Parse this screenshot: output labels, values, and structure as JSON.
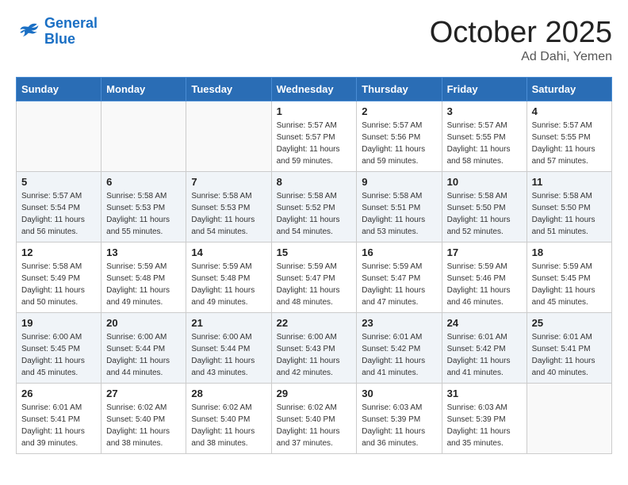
{
  "header": {
    "logo_line1": "General",
    "logo_line2": "Blue",
    "month": "October 2025",
    "location": "Ad Dahi, Yemen"
  },
  "weekdays": [
    "Sunday",
    "Monday",
    "Tuesday",
    "Wednesday",
    "Thursday",
    "Friday",
    "Saturday"
  ],
  "weeks": [
    [
      {
        "day": "",
        "sunrise": "",
        "sunset": "",
        "daylight": ""
      },
      {
        "day": "",
        "sunrise": "",
        "sunset": "",
        "daylight": ""
      },
      {
        "day": "",
        "sunrise": "",
        "sunset": "",
        "daylight": ""
      },
      {
        "day": "1",
        "sunrise": "Sunrise: 5:57 AM",
        "sunset": "Sunset: 5:57 PM",
        "daylight": "Daylight: 11 hours and 59 minutes."
      },
      {
        "day": "2",
        "sunrise": "Sunrise: 5:57 AM",
        "sunset": "Sunset: 5:56 PM",
        "daylight": "Daylight: 11 hours and 59 minutes."
      },
      {
        "day": "3",
        "sunrise": "Sunrise: 5:57 AM",
        "sunset": "Sunset: 5:55 PM",
        "daylight": "Daylight: 11 hours and 58 minutes."
      },
      {
        "day": "4",
        "sunrise": "Sunrise: 5:57 AM",
        "sunset": "Sunset: 5:55 PM",
        "daylight": "Daylight: 11 hours and 57 minutes."
      }
    ],
    [
      {
        "day": "5",
        "sunrise": "Sunrise: 5:57 AM",
        "sunset": "Sunset: 5:54 PM",
        "daylight": "Daylight: 11 hours and 56 minutes."
      },
      {
        "day": "6",
        "sunrise": "Sunrise: 5:58 AM",
        "sunset": "Sunset: 5:53 PM",
        "daylight": "Daylight: 11 hours and 55 minutes."
      },
      {
        "day": "7",
        "sunrise": "Sunrise: 5:58 AM",
        "sunset": "Sunset: 5:53 PM",
        "daylight": "Daylight: 11 hours and 54 minutes."
      },
      {
        "day": "8",
        "sunrise": "Sunrise: 5:58 AM",
        "sunset": "Sunset: 5:52 PM",
        "daylight": "Daylight: 11 hours and 54 minutes."
      },
      {
        "day": "9",
        "sunrise": "Sunrise: 5:58 AM",
        "sunset": "Sunset: 5:51 PM",
        "daylight": "Daylight: 11 hours and 53 minutes."
      },
      {
        "day": "10",
        "sunrise": "Sunrise: 5:58 AM",
        "sunset": "Sunset: 5:50 PM",
        "daylight": "Daylight: 11 hours and 52 minutes."
      },
      {
        "day": "11",
        "sunrise": "Sunrise: 5:58 AM",
        "sunset": "Sunset: 5:50 PM",
        "daylight": "Daylight: 11 hours and 51 minutes."
      }
    ],
    [
      {
        "day": "12",
        "sunrise": "Sunrise: 5:58 AM",
        "sunset": "Sunset: 5:49 PM",
        "daylight": "Daylight: 11 hours and 50 minutes."
      },
      {
        "day": "13",
        "sunrise": "Sunrise: 5:59 AM",
        "sunset": "Sunset: 5:48 PM",
        "daylight": "Daylight: 11 hours and 49 minutes."
      },
      {
        "day": "14",
        "sunrise": "Sunrise: 5:59 AM",
        "sunset": "Sunset: 5:48 PM",
        "daylight": "Daylight: 11 hours and 49 minutes."
      },
      {
        "day": "15",
        "sunrise": "Sunrise: 5:59 AM",
        "sunset": "Sunset: 5:47 PM",
        "daylight": "Daylight: 11 hours and 48 minutes."
      },
      {
        "day": "16",
        "sunrise": "Sunrise: 5:59 AM",
        "sunset": "Sunset: 5:47 PM",
        "daylight": "Daylight: 11 hours and 47 minutes."
      },
      {
        "day": "17",
        "sunrise": "Sunrise: 5:59 AM",
        "sunset": "Sunset: 5:46 PM",
        "daylight": "Daylight: 11 hours and 46 minutes."
      },
      {
        "day": "18",
        "sunrise": "Sunrise: 5:59 AM",
        "sunset": "Sunset: 5:45 PM",
        "daylight": "Daylight: 11 hours and 45 minutes."
      }
    ],
    [
      {
        "day": "19",
        "sunrise": "Sunrise: 6:00 AM",
        "sunset": "Sunset: 5:45 PM",
        "daylight": "Daylight: 11 hours and 45 minutes."
      },
      {
        "day": "20",
        "sunrise": "Sunrise: 6:00 AM",
        "sunset": "Sunset: 5:44 PM",
        "daylight": "Daylight: 11 hours and 44 minutes."
      },
      {
        "day": "21",
        "sunrise": "Sunrise: 6:00 AM",
        "sunset": "Sunset: 5:44 PM",
        "daylight": "Daylight: 11 hours and 43 minutes."
      },
      {
        "day": "22",
        "sunrise": "Sunrise: 6:00 AM",
        "sunset": "Sunset: 5:43 PM",
        "daylight": "Daylight: 11 hours and 42 minutes."
      },
      {
        "day": "23",
        "sunrise": "Sunrise: 6:01 AM",
        "sunset": "Sunset: 5:42 PM",
        "daylight": "Daylight: 11 hours and 41 minutes."
      },
      {
        "day": "24",
        "sunrise": "Sunrise: 6:01 AM",
        "sunset": "Sunset: 5:42 PM",
        "daylight": "Daylight: 11 hours and 41 minutes."
      },
      {
        "day": "25",
        "sunrise": "Sunrise: 6:01 AM",
        "sunset": "Sunset: 5:41 PM",
        "daylight": "Daylight: 11 hours and 40 minutes."
      }
    ],
    [
      {
        "day": "26",
        "sunrise": "Sunrise: 6:01 AM",
        "sunset": "Sunset: 5:41 PM",
        "daylight": "Daylight: 11 hours and 39 minutes."
      },
      {
        "day": "27",
        "sunrise": "Sunrise: 6:02 AM",
        "sunset": "Sunset: 5:40 PM",
        "daylight": "Daylight: 11 hours and 38 minutes."
      },
      {
        "day": "28",
        "sunrise": "Sunrise: 6:02 AM",
        "sunset": "Sunset: 5:40 PM",
        "daylight": "Daylight: 11 hours and 38 minutes."
      },
      {
        "day": "29",
        "sunrise": "Sunrise: 6:02 AM",
        "sunset": "Sunset: 5:40 PM",
        "daylight": "Daylight: 11 hours and 37 minutes."
      },
      {
        "day": "30",
        "sunrise": "Sunrise: 6:03 AM",
        "sunset": "Sunset: 5:39 PM",
        "daylight": "Daylight: 11 hours and 36 minutes."
      },
      {
        "day": "31",
        "sunrise": "Sunrise: 6:03 AM",
        "sunset": "Sunset: 5:39 PM",
        "daylight": "Daylight: 11 hours and 35 minutes."
      },
      {
        "day": "",
        "sunrise": "",
        "sunset": "",
        "daylight": ""
      }
    ]
  ]
}
